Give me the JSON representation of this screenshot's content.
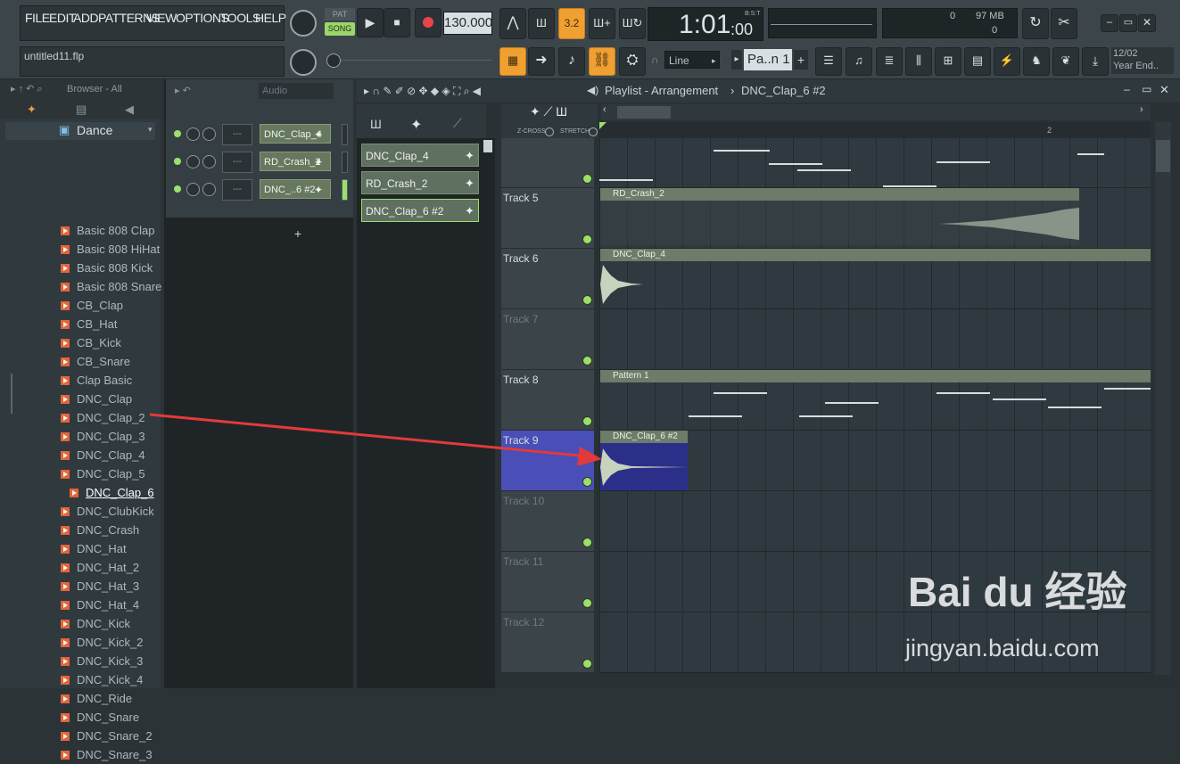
{
  "menu": [
    "FILE",
    "EDIT",
    "ADD",
    "PATTERNS",
    "VIEW",
    "OPTIONS",
    "TOOLS",
    "HELP"
  ],
  "transport": {
    "pat": "PAT",
    "song": "SONG",
    "tempo": "130.000"
  },
  "time": {
    "main": "1:01",
    "sub": ":00",
    "unit": "B:S:T"
  },
  "status": {
    "cpu_value": "0",
    "memory": "97 MB",
    "poly": "0"
  },
  "snap": "Line",
  "pattern": "Pa..n 1",
  "news": {
    "date": "12/02",
    "text": "Year End.."
  },
  "project": "untitled11.flp",
  "browser": {
    "title": "Browser - All",
    "folder": "Dance",
    "items": [
      "Basic 808 Clap",
      "Basic 808 HiHat",
      "Basic 808 Kick",
      "Basic 808 Snare",
      "CB_Clap",
      "CB_Hat",
      "CB_Kick",
      "CB_Snare",
      "Clap Basic",
      "DNC_Clap",
      "DNC_Clap_2",
      "DNC_Clap_3",
      "DNC_Clap_4",
      "DNC_Clap_5",
      "DNC_Clap_6",
      "DNC_ClubKick",
      "DNC_Crash",
      "DNC_Hat",
      "DNC_Hat_2",
      "DNC_Hat_3",
      "DNC_Hat_4",
      "DNC_Kick",
      "DNC_Kick_2",
      "DNC_Kick_3",
      "DNC_Kick_4",
      "DNC_Ride",
      "DNC_Snare",
      "DNC_Snare_2",
      "DNC_Snare_3"
    ],
    "selected": "DNC_Clap_6"
  },
  "rack": {
    "filter": "Audio",
    "channels": [
      {
        "slot": "---",
        "name": "DNC_Clap_4"
      },
      {
        "slot": "---",
        "name": "RD_Crash_2"
      },
      {
        "slot": "---",
        "name": "DNC_..6 #2"
      }
    ],
    "add": "+"
  },
  "playlist": {
    "title": "Playlist - Arrangement",
    "crumb": "DNC_Clap_6 #2",
    "zcross": "Z-CROSS",
    "stretch": "STRETCH",
    "bar_marker": "2",
    "picker": [
      "DNC_Clap_4",
      "RD_Crash_2",
      "DNC_Clap_6 #2"
    ],
    "tracks": [
      "",
      "Track 5",
      "Track 6",
      "Track 7",
      "Track 8",
      "Track 9",
      "Track 10",
      "Track 11",
      "Track 12"
    ],
    "clips": {
      "crash": "RD_Crash_2",
      "clap4": "DNC_Clap_4",
      "pattern": "Pattern 1",
      "clap6": "DNC_Clap_6 #2"
    }
  },
  "watermark": {
    "brand": "Bai du 经验",
    "url": "jingyan.baidu.com"
  }
}
